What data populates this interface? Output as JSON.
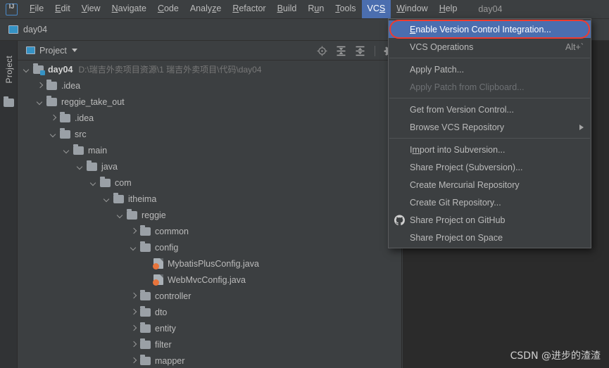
{
  "window": {
    "title": "day04",
    "logo_icon": "intellij-idea-logo-icon"
  },
  "menubar": {
    "items": [
      {
        "label": "File",
        "mnemonic": "F",
        "selected": false
      },
      {
        "label": "Edit",
        "mnemonic": "E",
        "selected": false
      },
      {
        "label": "View",
        "mnemonic": "V",
        "selected": false
      },
      {
        "label": "Navigate",
        "mnemonic": "N",
        "selected": false
      },
      {
        "label": "Code",
        "mnemonic": "C",
        "selected": false
      },
      {
        "label": "Analyze",
        "mnemonic": "z",
        "selected": false
      },
      {
        "label": "Refactor",
        "mnemonic": "R",
        "selected": false
      },
      {
        "label": "Build",
        "mnemonic": "B",
        "selected": false
      },
      {
        "label": "Run",
        "mnemonic": "u",
        "selected": false
      },
      {
        "label": "Tools",
        "mnemonic": "T",
        "selected": false
      },
      {
        "label": "VCS",
        "mnemonic": "S",
        "selected": true
      },
      {
        "label": "Window",
        "mnemonic": "W",
        "selected": false
      },
      {
        "label": "Help",
        "mnemonic": "H",
        "selected": false
      }
    ]
  },
  "breadcrumb": {
    "label": "day04",
    "icon": "module-icon"
  },
  "tool_stripe": {
    "tab_label": "Project",
    "folder_icon": "folder-icon"
  },
  "project_panel": {
    "title": "Project",
    "title_icon": "module-icon",
    "dropdown_icon": "chevron-down-icon",
    "tools": [
      {
        "name": "locate-in-tree-icon",
        "tooltip": "Select Opened File"
      },
      {
        "name": "expand-all-icon",
        "tooltip": "Expand All"
      },
      {
        "name": "collapse-all-icon",
        "tooltip": "Collapse All"
      },
      {
        "name": "gear-icon",
        "tooltip": "Settings"
      }
    ],
    "tree": [
      {
        "label": "day04",
        "path": "D:\\瑞吉外卖项目资源\\1 瑞吉外卖项目\\代码\\day04",
        "depth": 0,
        "state": "expanded",
        "icon": "module-folder-icon",
        "bold": true
      },
      {
        "label": ".idea",
        "path": "",
        "depth": 1,
        "state": "collapsed",
        "icon": "folder-icon",
        "bold": false
      },
      {
        "label": "reggie_take_out",
        "path": "",
        "depth": 1,
        "state": "expanded",
        "icon": "folder-icon",
        "bold": false
      },
      {
        "label": ".idea",
        "path": "",
        "depth": 2,
        "state": "collapsed",
        "icon": "folder-icon",
        "bold": false
      },
      {
        "label": "src",
        "path": "",
        "depth": 2,
        "state": "expanded",
        "icon": "folder-icon",
        "bold": false
      },
      {
        "label": "main",
        "path": "",
        "depth": 3,
        "state": "expanded",
        "icon": "folder-icon",
        "bold": false
      },
      {
        "label": "java",
        "path": "",
        "depth": 4,
        "state": "expanded",
        "icon": "folder-icon",
        "bold": false
      },
      {
        "label": "com",
        "path": "",
        "depth": 5,
        "state": "expanded",
        "icon": "folder-icon",
        "bold": false
      },
      {
        "label": "itheima",
        "path": "",
        "depth": 6,
        "state": "expanded",
        "icon": "folder-icon",
        "bold": false
      },
      {
        "label": "reggie",
        "path": "",
        "depth": 7,
        "state": "expanded",
        "icon": "folder-icon",
        "bold": false
      },
      {
        "label": "common",
        "path": "",
        "depth": 8,
        "state": "collapsed",
        "icon": "folder-icon",
        "bold": false
      },
      {
        "label": "config",
        "path": "",
        "depth": 8,
        "state": "expanded",
        "icon": "folder-icon",
        "bold": false
      },
      {
        "label": "MybatisPlusConfig.java",
        "path": "",
        "depth": 9,
        "state": "leaf",
        "icon": "java-class-icon",
        "bold": false
      },
      {
        "label": "WebMvcConfig.java",
        "path": "",
        "depth": 9,
        "state": "leaf",
        "icon": "java-class-icon",
        "bold": false
      },
      {
        "label": "controller",
        "path": "",
        "depth": 8,
        "state": "collapsed",
        "icon": "folder-icon",
        "bold": false
      },
      {
        "label": "dto",
        "path": "",
        "depth": 8,
        "state": "collapsed",
        "icon": "folder-icon",
        "bold": false
      },
      {
        "label": "entity",
        "path": "",
        "depth": 8,
        "state": "collapsed",
        "icon": "folder-icon",
        "bold": false
      },
      {
        "label": "filter",
        "path": "",
        "depth": 8,
        "state": "collapsed",
        "icon": "folder-icon",
        "bold": false
      },
      {
        "label": "mapper",
        "path": "",
        "depth": 8,
        "state": "collapsed",
        "icon": "folder-icon",
        "bold": false
      }
    ]
  },
  "vcs_menu": {
    "items": [
      {
        "kind": "item",
        "label": "Enable Version Control Integration...",
        "mnemonic": "E",
        "accel": "",
        "state": "highlighted",
        "icon": "",
        "submenu": false
      },
      {
        "kind": "item",
        "label": "VCS Operations",
        "mnemonic": "",
        "accel": "Alt+`",
        "state": "normal",
        "icon": "",
        "submenu": false
      },
      {
        "kind": "separator"
      },
      {
        "kind": "item",
        "label": "Apply Patch...",
        "mnemonic": "",
        "accel": "",
        "state": "normal",
        "icon": "",
        "submenu": false
      },
      {
        "kind": "item",
        "label": "Apply Patch from Clipboard...",
        "mnemonic": "",
        "accel": "",
        "state": "disabled",
        "icon": "",
        "submenu": false
      },
      {
        "kind": "separator"
      },
      {
        "kind": "item",
        "label": "Get from Version Control...",
        "mnemonic": "",
        "accel": "",
        "state": "normal",
        "icon": "",
        "submenu": false
      },
      {
        "kind": "item",
        "label": "Browse VCS Repository",
        "mnemonic": "",
        "accel": "",
        "state": "normal",
        "icon": "",
        "submenu": true
      },
      {
        "kind": "separator"
      },
      {
        "kind": "item",
        "label": "Import into Subversion...",
        "mnemonic": "m",
        "accel": "",
        "state": "normal",
        "icon": "",
        "submenu": false
      },
      {
        "kind": "item",
        "label": "Share Project (Subversion)...",
        "mnemonic": "",
        "accel": "",
        "state": "normal",
        "icon": "",
        "submenu": false
      },
      {
        "kind": "item",
        "label": "Create Mercurial Repository",
        "mnemonic": "",
        "accel": "",
        "state": "normal",
        "icon": "",
        "submenu": false
      },
      {
        "kind": "item",
        "label": "Create Git Repository...",
        "mnemonic": "",
        "accel": "",
        "state": "normal",
        "icon": "",
        "submenu": false
      },
      {
        "kind": "item",
        "label": "Share Project on GitHub",
        "mnemonic": "",
        "accel": "",
        "state": "normal",
        "icon": "github-icon",
        "submenu": false
      },
      {
        "kind": "item",
        "label": "Share Project on Space",
        "mnemonic": "",
        "accel": "",
        "state": "normal",
        "icon": "",
        "submenu": false
      }
    ]
  },
  "annotation": {
    "shape": "rounded-rectangle",
    "color": "#ef3b2d",
    "target": "Enable Version Control Integration..."
  },
  "watermark": {
    "text": "CSDN @进步的渣渣"
  },
  "colors": {
    "background": "#3c3f41",
    "editor_background": "#2b2b2b",
    "stripe_background": "#313335",
    "selection_blue": "#4b6eaf",
    "text": "#bbbbbb",
    "text_dim": "#787878",
    "annotation_red": "#ef3b2d",
    "module_icon": "#3592c4",
    "java_icon": "#e8743b"
  }
}
